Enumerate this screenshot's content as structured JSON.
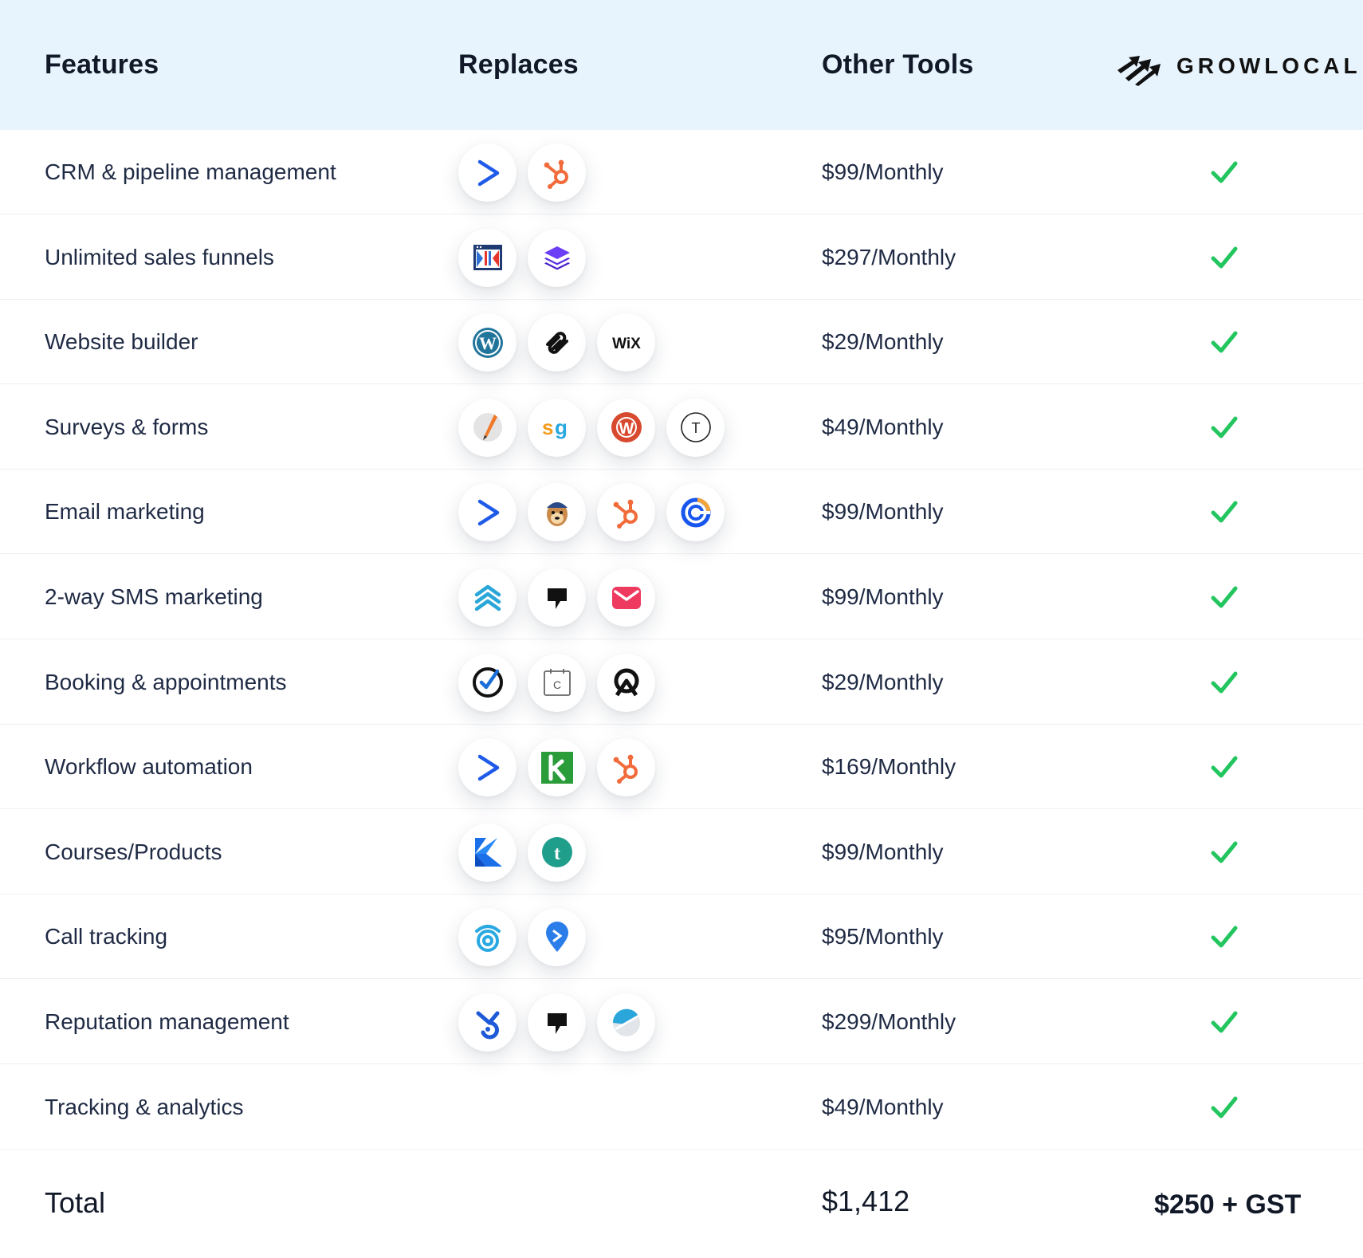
{
  "header": {
    "features": "Features",
    "replaces": "Replaces",
    "other_tools": "Other Tools",
    "brand": "GROWLOCAL"
  },
  "rows": [
    {
      "feature": "CRM & pipeline management",
      "price": "$99/Monthly",
      "icons": [
        "activecampaign-icon",
        "hubspot-icon"
      ]
    },
    {
      "feature": "Unlimited sales funnels",
      "price": "$297/Monthly",
      "icons": [
        "clickfunnels-icon",
        "layers-icon"
      ]
    },
    {
      "feature": "Website builder",
      "price": "$29/Monthly",
      "icons": [
        "wordpress-icon",
        "squarespace-icon",
        "wix-icon"
      ]
    },
    {
      "feature": "Surveys & forms",
      "price": "$49/Monthly",
      "icons": [
        "pencil-form-icon",
        "surveygizmo-icon",
        "wufoo-icon",
        "typeform-icon"
      ]
    },
    {
      "feature": "Email marketing",
      "price": "$99/Monthly",
      "icons": [
        "activecampaign-icon",
        "mailchimp-icon",
        "hubspot-icon",
        "constant-contact-icon"
      ]
    },
    {
      "feature": "2-way SMS marketing",
      "price": "$99/Monthly",
      "icons": [
        "chevrons-up-icon",
        "podium-icon",
        "envelope-icon"
      ]
    },
    {
      "feature": "Booking & appointments",
      "price": "$29/Monthly",
      "icons": [
        "check-circle-icon",
        "calendly-icon",
        "acuity-icon"
      ]
    },
    {
      "feature": "Workflow automation",
      "price": "$169/Monthly",
      "icons": [
        "activecampaign-icon",
        "keap-icon",
        "hubspot-icon"
      ]
    },
    {
      "feature": "Courses/Products",
      "price": "$99/Monthly",
      "icons": [
        "kajabi-icon",
        "teachable-icon"
      ]
    },
    {
      "feature": "Call tracking",
      "price": "$95/Monthly",
      "icons": [
        "callrail-icon",
        "location-pin-icon"
      ]
    },
    {
      "feature": "Reputation management",
      "price": "$299/Monthly",
      "icons": [
        "birdeye-icon",
        "podium-icon",
        "half-circle-icon"
      ]
    },
    {
      "feature": "Tracking & analytics",
      "price": "$49/Monthly",
      "icons": []
    }
  ],
  "total": {
    "label": "Total",
    "other_tools": "$1,412",
    "growlocal": "$250 + GST"
  },
  "colors": {
    "header_bg": "#e8f4fd",
    "check": "#22c55e",
    "text": "#1f2a44"
  }
}
